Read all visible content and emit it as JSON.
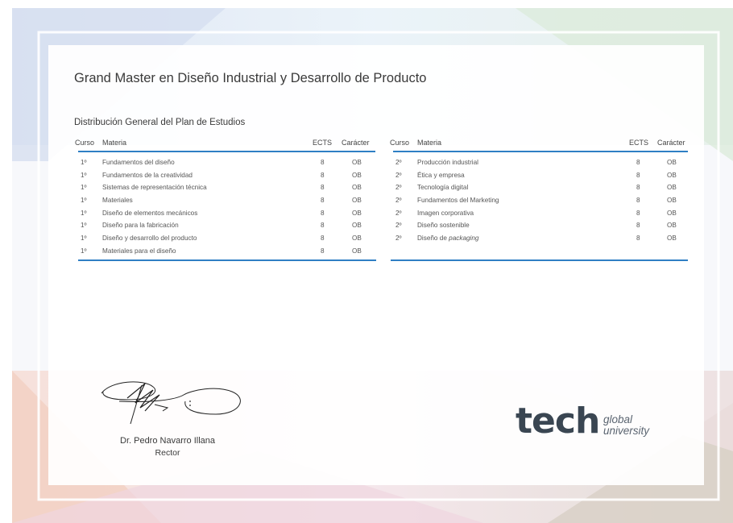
{
  "document": {
    "title": "Grand Master en Diseño Industrial y Desarrollo de Producto",
    "subtitle": "Distribución General del Plan de Estudios"
  },
  "table_headers": [
    "Curso",
    "Materia",
    "ECTS",
    "Carácter"
  ],
  "left_table": [
    {
      "curso": "1º",
      "materia": "Fundamentos del diseño",
      "ects": "8",
      "caracter": "OB"
    },
    {
      "curso": "1º",
      "materia": "Fundamentos de la creatividad",
      "ects": "8",
      "caracter": "OB"
    },
    {
      "curso": "1º",
      "materia": "Sistemas de representación técnica",
      "ects": "8",
      "caracter": "OB"
    },
    {
      "curso": "1º",
      "materia": "Materiales",
      "ects": "8",
      "caracter": "OB"
    },
    {
      "curso": "1º",
      "materia": "Diseño de elementos mecánicos",
      "ects": "8",
      "caracter": "OB"
    },
    {
      "curso": "1º",
      "materia": "Diseño para la fabricación",
      "ects": "8",
      "caracter": "OB"
    },
    {
      "curso": "1º",
      "materia": "Diseño y desarrollo del producto",
      "ects": "8",
      "caracter": "OB"
    },
    {
      "curso": "1º",
      "materia": "Materiales para el diseño",
      "ects": "8",
      "caracter": "OB"
    }
  ],
  "right_table": [
    {
      "curso": "2º",
      "materia": "Producción industrial",
      "ects": "8",
      "caracter": "OB"
    },
    {
      "curso": "2º",
      "materia": "Ética y empresa",
      "ects": "8",
      "caracter": "OB"
    },
    {
      "curso": "2º",
      "materia": "Tecnología digital",
      "ects": "8",
      "caracter": "OB"
    },
    {
      "curso": "2º",
      "materia": "Fundamentos del Marketing",
      "ects": "8",
      "caracter": "OB"
    },
    {
      "curso": "2º",
      "materia": "Imagen corporativa",
      "ects": "8",
      "caracter": "OB"
    },
    {
      "curso": "2º",
      "materia": "Diseño sostenible",
      "ects": "8",
      "caracter": "OB"
    },
    {
      "curso": "2º",
      "materia": "Diseño de packaging",
      "ects": "8",
      "caracter": "OB"
    }
  ],
  "signatory": {
    "name": "Dr. Pedro Navarro Illana",
    "role": "Rector"
  },
  "logo": {
    "word": "tech",
    "line1": "global",
    "line2": "university",
    "text_color": "#3a4652"
  },
  "colors": {
    "accent_line": "#2f7fc4"
  }
}
